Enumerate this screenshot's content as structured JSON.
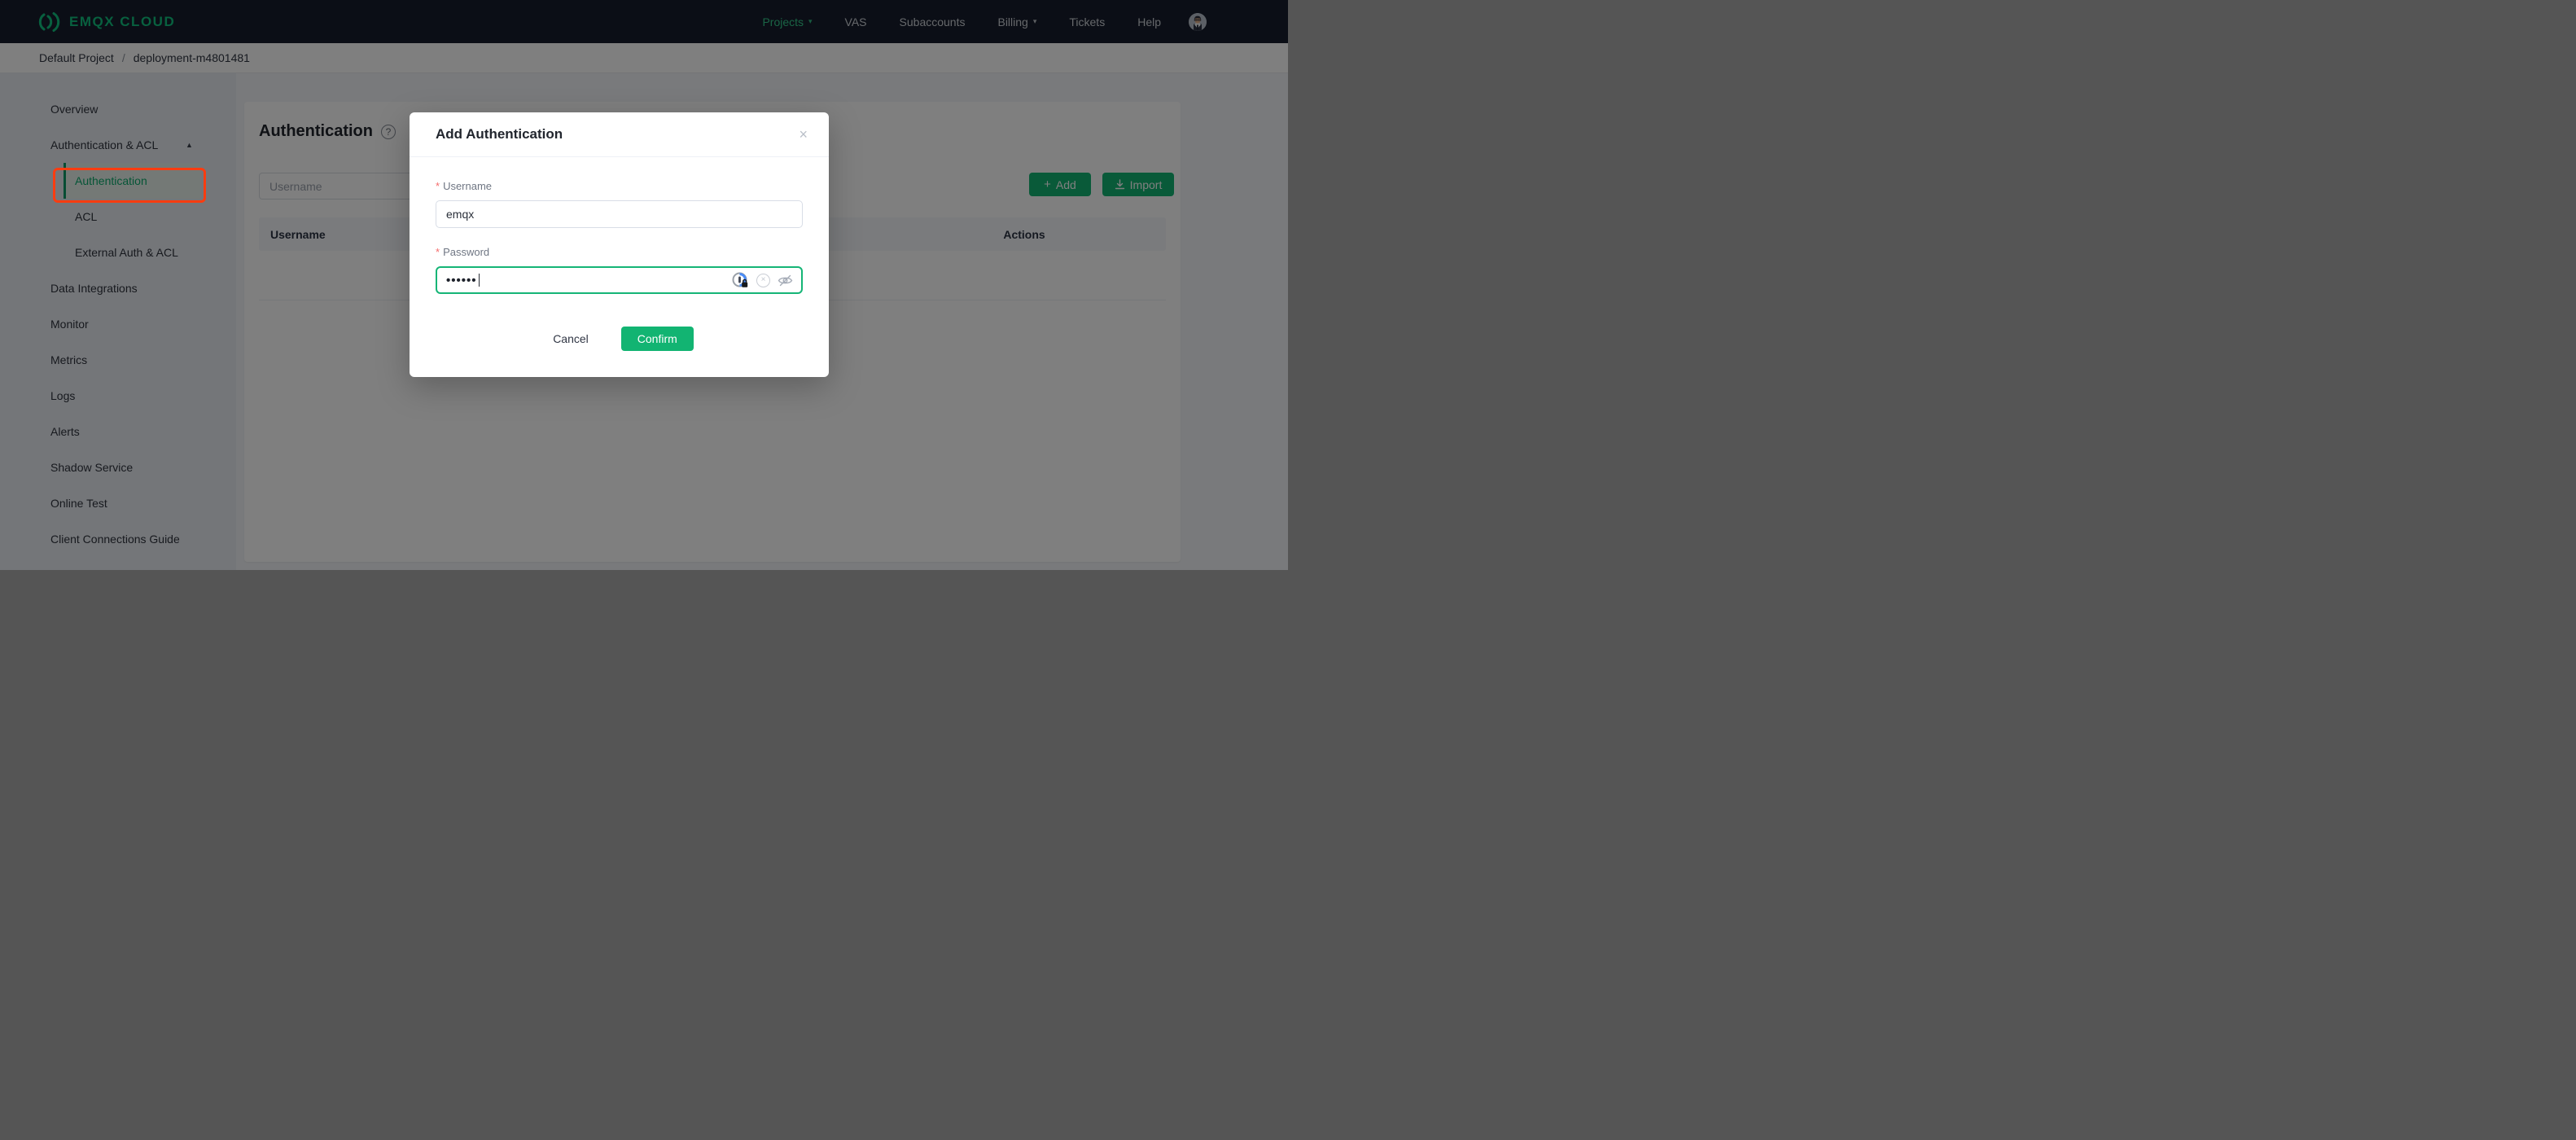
{
  "navbar": {
    "brand": "EMQX CLOUD",
    "items": [
      {
        "label": "Projects",
        "caret": true,
        "active": true
      },
      {
        "label": "VAS"
      },
      {
        "label": "Subaccounts"
      },
      {
        "label": "Billing",
        "caret": true
      },
      {
        "label": "Tickets"
      },
      {
        "label": "Help"
      }
    ]
  },
  "breadcrumb": {
    "project": "Default Project",
    "separator": "/",
    "deployment": "deployment-m4801481"
  },
  "sidebar": {
    "items": [
      {
        "label": "Overview"
      },
      {
        "label": "Authentication & ACL",
        "expanded": true
      },
      {
        "label": "Authentication",
        "sub": true,
        "active": true,
        "annotated": true
      },
      {
        "label": "ACL",
        "sub": true
      },
      {
        "label": "External Auth & ACL",
        "sub": true
      },
      {
        "label": "Data Integrations"
      },
      {
        "label": "Monitor"
      },
      {
        "label": "Metrics"
      },
      {
        "label": "Logs"
      },
      {
        "label": "Alerts"
      },
      {
        "label": "Shadow Service"
      },
      {
        "label": "Online Test"
      },
      {
        "label": "Client Connections Guide"
      }
    ]
  },
  "main": {
    "title": "Authentication",
    "search_placeholder": "Username",
    "add_label": "Add",
    "import_label": "Import",
    "table": {
      "headers": [
        "Username",
        "Actions"
      ],
      "rows": []
    }
  },
  "modal": {
    "title": "Add Authentication",
    "required_marker": "*",
    "username_label": "Username",
    "username_value": "emqx",
    "password_label": "Password",
    "password_value": "••••••",
    "cancel_label": "Cancel",
    "confirm_label": "Confirm"
  },
  "icons": {
    "caret_down": "▾",
    "caret_up": "▲",
    "plus": "+",
    "help": "?",
    "close": "×",
    "clear": "×",
    "logo_mark": "emqx-arcs-logo",
    "import_icon": "download-icon",
    "password_manager_icon": "blue-lock-extension-icon",
    "eye_icon": "eye-off-icon"
  },
  "colors": {
    "accent_green": "#12b472",
    "brand_green": "#10c07f",
    "nav_active_green": "#35c98b",
    "sidebar_active_green": "#0bab6d",
    "focus_border_green": "#15b576",
    "required_red": "#f56c6c",
    "annotation_red": "#fb3c10",
    "navbar_bg": "#161d2c",
    "overlay": "rgba(0,0,0,0.5)"
  }
}
